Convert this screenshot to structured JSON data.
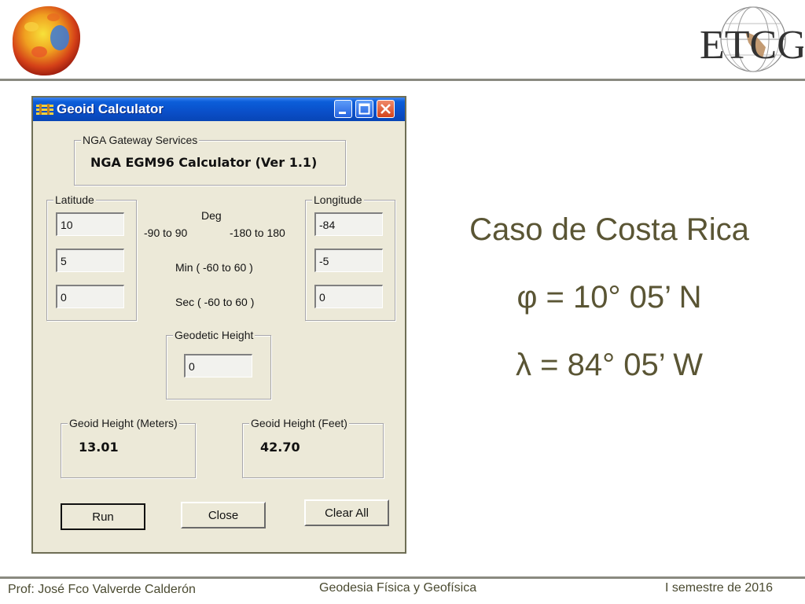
{
  "slide": {
    "case_title": "Caso de Costa Rica",
    "phi_line": "φ = 10° 05’ N",
    "lambda_line": "λ = 84° 05’ W",
    "logo_text": "ETCG"
  },
  "footer": {
    "author": "Prof: José Fco Valverde Calderón",
    "course": "Geodesia Física y Geofísica",
    "term": "I semestre de 2016"
  },
  "window": {
    "title": "Geoid Calculator",
    "gateway_group_label": "NGA Gateway Services",
    "gateway_value": "NGA EGM96 Calculator (Ver 1.1)",
    "latitude_group_label": "Latitude",
    "longitude_group_label": "Longitude",
    "latitude": {
      "deg": "10",
      "min": "5",
      "sec": "0"
    },
    "longitude": {
      "deg": "-84",
      "min": "-5",
      "sec": "0"
    },
    "labels": {
      "deg": "Deg",
      "lat_range": "-90 to 90",
      "lon_range": "-180 to 180",
      "min": "Min ( -60 to 60 )",
      "sec": "Sec ( -60 to 60 )"
    },
    "geodetic_height_label": "Geodetic Height",
    "geodetic_height": "0",
    "geoid_height_meters_label": "Geoid Height (Meters)",
    "geoid_height_meters": "13.01",
    "geoid_height_feet_label": "Geoid Height (Feet)",
    "geoid_height_feet": "42.70",
    "buttons": {
      "run": "Run",
      "close": "Close",
      "clear_all": "Clear All"
    }
  },
  "colors": {
    "slide_text": "#5a5534",
    "titlebar": "#0a4fc9",
    "window_face": "#ece9d8"
  }
}
